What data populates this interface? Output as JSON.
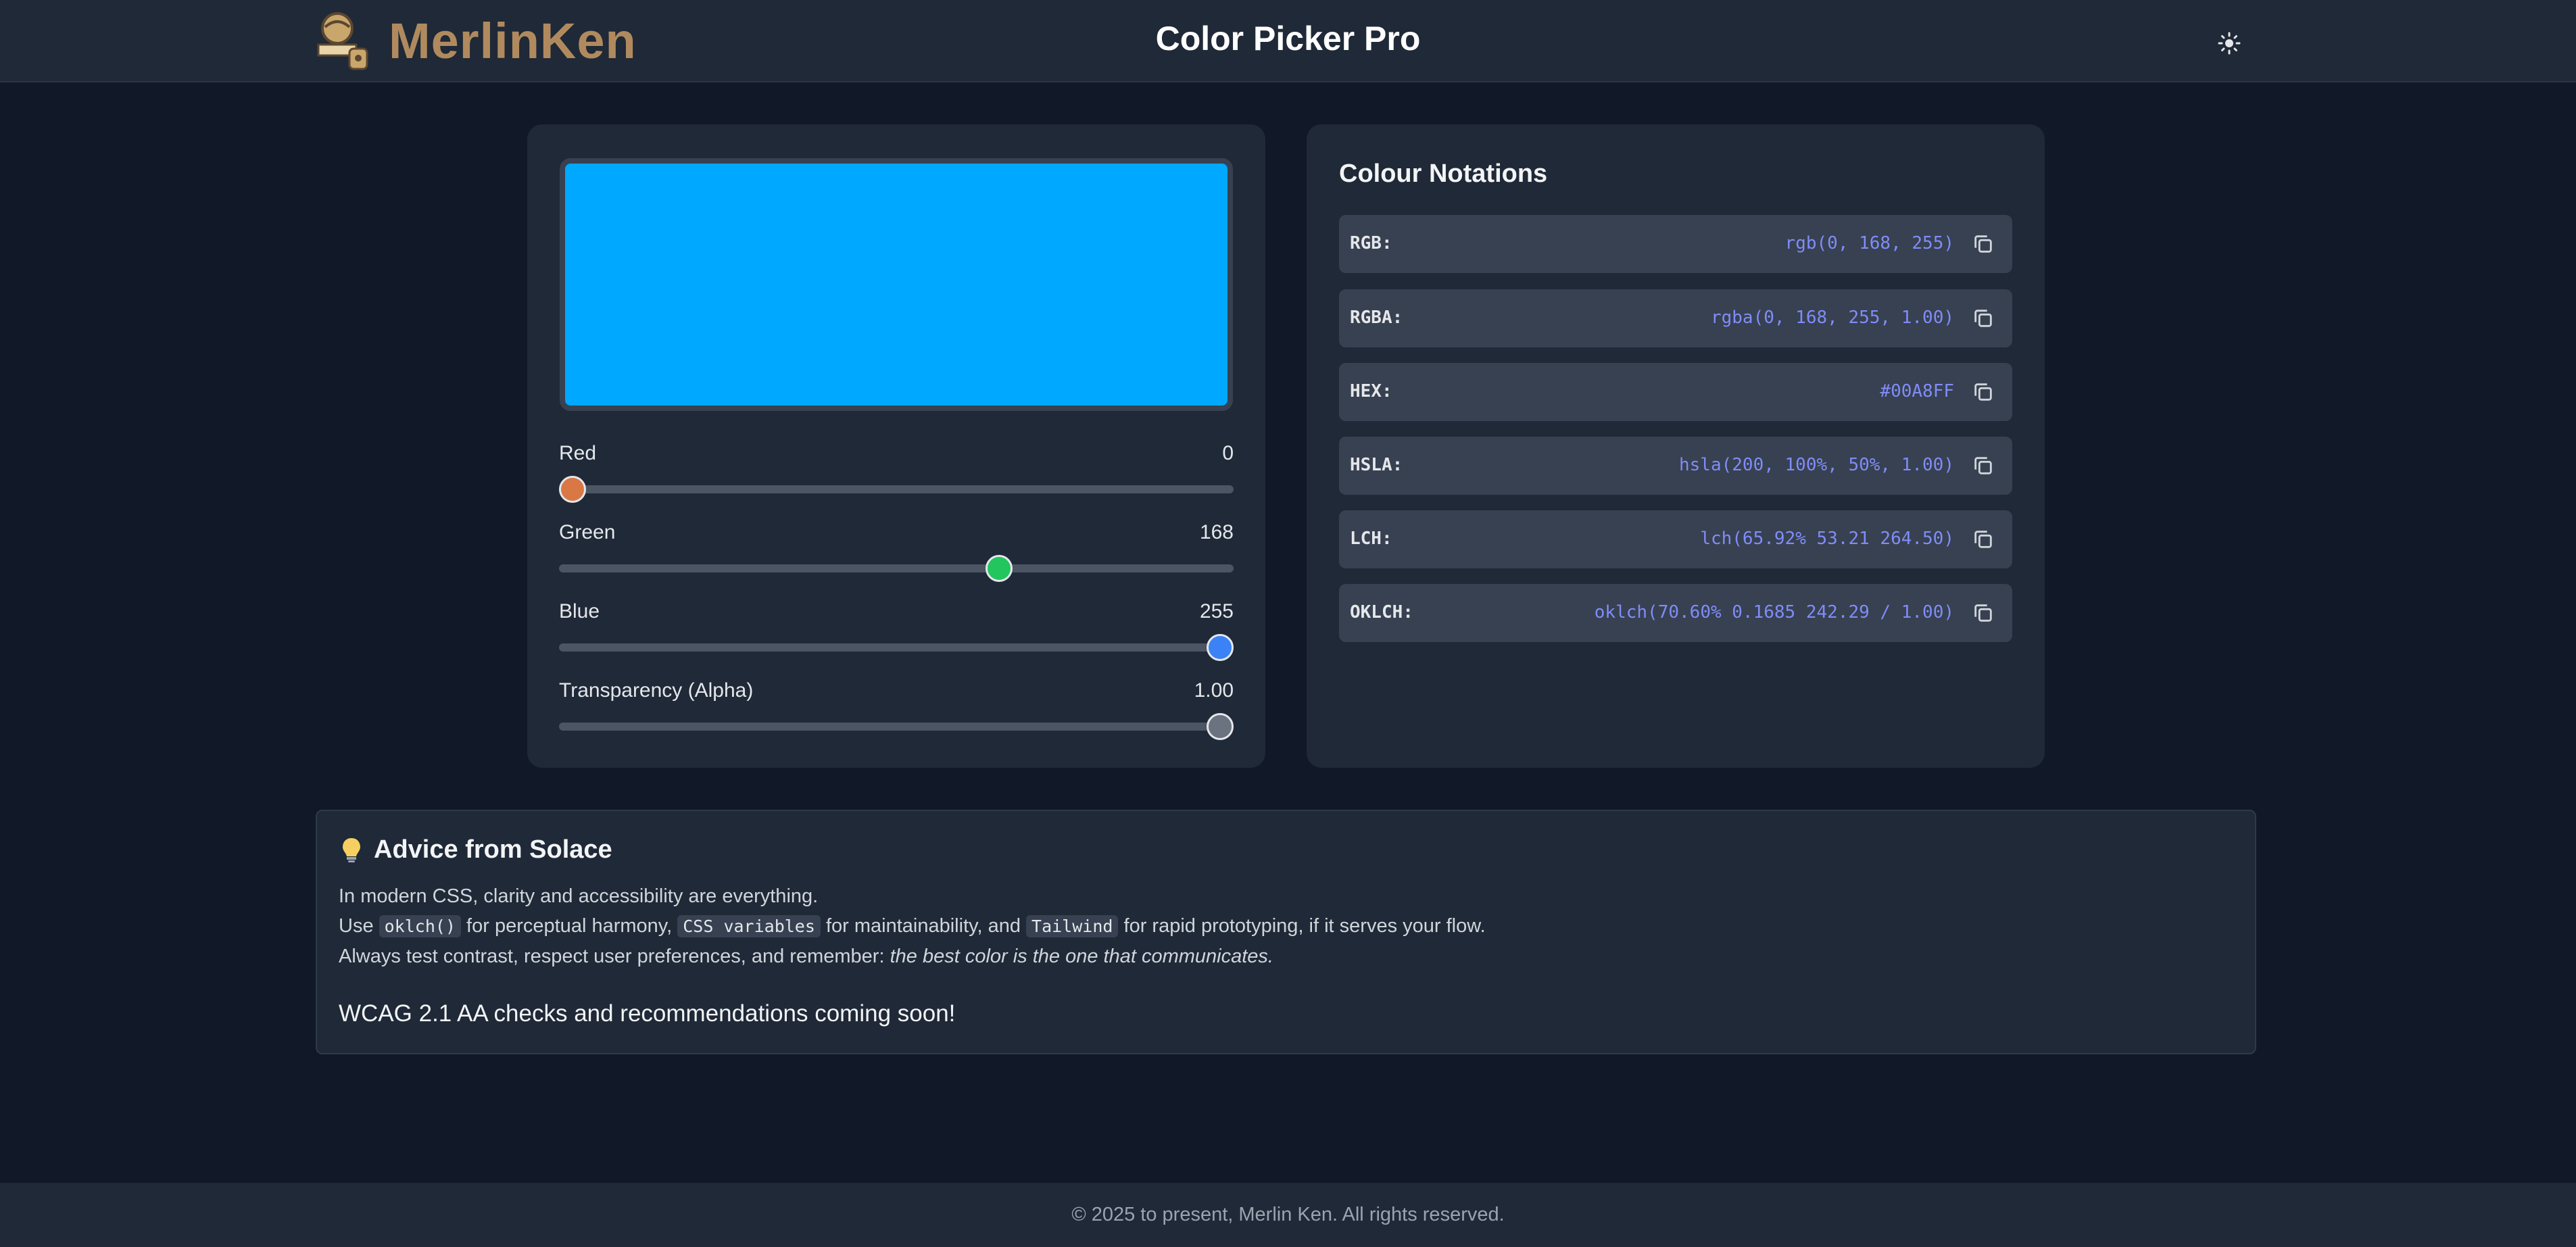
{
  "header": {
    "brand_name": "MerlinKen",
    "title": "Color Picker Pro",
    "theme_icon": "sun-icon"
  },
  "picker": {
    "swatch_color": "#00A8FF",
    "sliders": [
      {
        "label": "Red",
        "value": "0",
        "fraction": 0.0,
        "color": "#d97845"
      },
      {
        "label": "Green",
        "value": "168",
        "fraction": 0.659,
        "color": "#22c55e"
      },
      {
        "label": "Blue",
        "value": "255",
        "fraction": 1.0,
        "color": "#3b82f6"
      },
      {
        "label": "Transparency (Alpha)",
        "value": "1.00",
        "fraction": 1.0,
        "color": "#6b7280"
      }
    ]
  },
  "notations": {
    "title": "Colour Notations",
    "rows": [
      {
        "label": "RGB:",
        "value": "rgb(0, 168, 255)"
      },
      {
        "label": "RGBA:",
        "value": "rgba(0, 168, 255, 1.00)"
      },
      {
        "label": "HEX:",
        "value": "#00A8FF"
      },
      {
        "label": "HSLA:",
        "value": "hsla(200, 100%, 50%, 1.00)"
      },
      {
        "label": "LCH:",
        "value": "lch(65.92% 53.21 264.50)"
      },
      {
        "label": "OKLCH:",
        "value": "oklch(70.60% 0.1685 242.29 / 1.00)"
      }
    ],
    "copy_icon": "copy-icon"
  },
  "advice": {
    "icon": "lightbulb-icon",
    "title": "Advice from Solace",
    "line1": "In modern CSS, clarity and accessibility are everything.",
    "line2_a": "Use ",
    "code1": "oklch()",
    "line2_b": " for perceptual harmony, ",
    "code2": "CSS variables",
    "line2_c": " for maintainability, and ",
    "code3": "Tailwind",
    "line2_d": " for rapid prototyping, if it serves your flow.",
    "line3_a": "Always test contrast, respect user preferences, and remember: ",
    "line3_em": "the best color is the one that communicates.",
    "note": "WCAG 2.1 AA checks and recommendations coming soon!"
  },
  "footer": {
    "text": "© 2025 to present, Merlin Ken. All rights reserved."
  },
  "colors": {
    "background": "#111827",
    "surface": "#1f2937",
    "row": "#374151",
    "accent_value": "#818cf8"
  }
}
